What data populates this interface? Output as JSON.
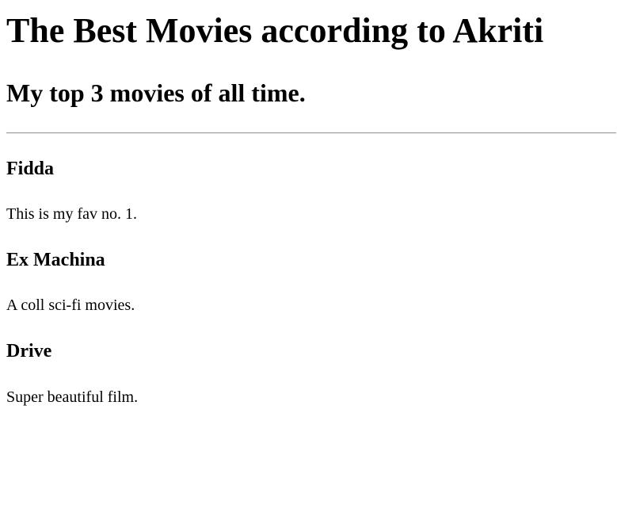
{
  "page": {
    "title": "The Best Movies according to Akriti",
    "subtitle": "My top 3 movies of all time."
  },
  "movies": [
    {
      "title": "Fidda",
      "description": "This is my fav no. 1."
    },
    {
      "title": "Ex Machina",
      "description": "A coll sci-fi movies."
    },
    {
      "title": "Drive",
      "description": "Super beautiful film."
    }
  ]
}
